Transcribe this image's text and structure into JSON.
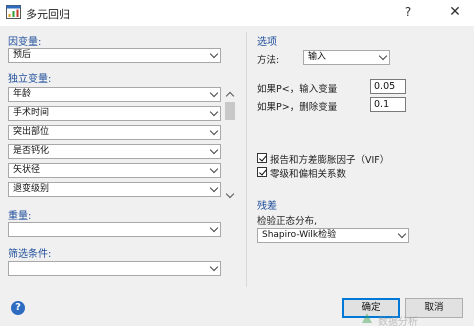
{
  "window": {
    "title": "多元回归",
    "help_glyph": "?",
    "close_glyph": "✕"
  },
  "left": {
    "dependent_label": "因变量:",
    "dependent_value": "预后",
    "independent_label": "独立变量:",
    "independent_items": [
      "年龄",
      "手术时间",
      "突出部位",
      "是否钙化",
      "矢状径",
      "退变级别"
    ],
    "weight_label": "重量:",
    "weight_value": "",
    "filter_label": "筛选条件:",
    "filter_value": ""
  },
  "right": {
    "options_label": "选项",
    "method_label": "方法:",
    "method_value": "输入",
    "enter_label": "如果P<，输入变量",
    "enter_value": "0.05",
    "remove_label": "如果P>，删除变量",
    "remove_value": "0.1",
    "check_vif_label": "报告和方差膨胀因子（VIF）",
    "check_vif_checked": true,
    "check_partial_label": "零级和偏相关系数",
    "check_partial_checked": true,
    "residuals_label": "残差",
    "normality_label": "检验正态分布,",
    "normality_value": "Shapiro-Wilk检验"
  },
  "footer": {
    "help_icon_glyph": "?",
    "ok_label": "确定",
    "cancel_label": "取消",
    "watermark": "数据分析"
  },
  "colors": {
    "accent_label": "#1f4e9c",
    "focus_border": "#0078d7",
    "help_icon": "#2d6cc0",
    "dialog_bg": "#f0f0f0"
  }
}
